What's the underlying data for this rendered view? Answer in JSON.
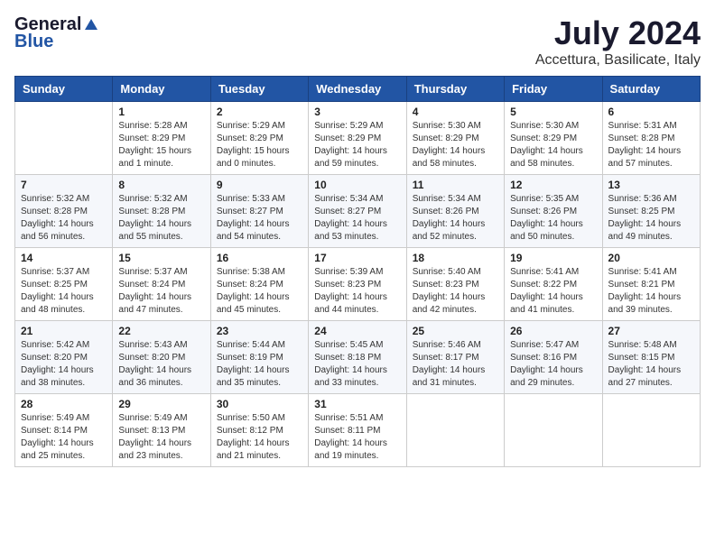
{
  "header": {
    "logo_general": "General",
    "logo_blue": "Blue",
    "month_title": "July 2024",
    "location": "Accettura, Basilicate, Italy"
  },
  "weekdays": [
    "Sunday",
    "Monday",
    "Tuesday",
    "Wednesday",
    "Thursday",
    "Friday",
    "Saturday"
  ],
  "weeks": [
    [
      {
        "day": "",
        "info": ""
      },
      {
        "day": "1",
        "info": "Sunrise: 5:28 AM\nSunset: 8:29 PM\nDaylight: 15 hours\nand 1 minute."
      },
      {
        "day": "2",
        "info": "Sunrise: 5:29 AM\nSunset: 8:29 PM\nDaylight: 15 hours\nand 0 minutes."
      },
      {
        "day": "3",
        "info": "Sunrise: 5:29 AM\nSunset: 8:29 PM\nDaylight: 14 hours\nand 59 minutes."
      },
      {
        "day": "4",
        "info": "Sunrise: 5:30 AM\nSunset: 8:29 PM\nDaylight: 14 hours\nand 58 minutes."
      },
      {
        "day": "5",
        "info": "Sunrise: 5:30 AM\nSunset: 8:29 PM\nDaylight: 14 hours\nand 58 minutes."
      },
      {
        "day": "6",
        "info": "Sunrise: 5:31 AM\nSunset: 8:28 PM\nDaylight: 14 hours\nand 57 minutes."
      }
    ],
    [
      {
        "day": "7",
        "info": "Sunrise: 5:32 AM\nSunset: 8:28 PM\nDaylight: 14 hours\nand 56 minutes."
      },
      {
        "day": "8",
        "info": "Sunrise: 5:32 AM\nSunset: 8:28 PM\nDaylight: 14 hours\nand 55 minutes."
      },
      {
        "day": "9",
        "info": "Sunrise: 5:33 AM\nSunset: 8:27 PM\nDaylight: 14 hours\nand 54 minutes."
      },
      {
        "day": "10",
        "info": "Sunrise: 5:34 AM\nSunset: 8:27 PM\nDaylight: 14 hours\nand 53 minutes."
      },
      {
        "day": "11",
        "info": "Sunrise: 5:34 AM\nSunset: 8:26 PM\nDaylight: 14 hours\nand 52 minutes."
      },
      {
        "day": "12",
        "info": "Sunrise: 5:35 AM\nSunset: 8:26 PM\nDaylight: 14 hours\nand 50 minutes."
      },
      {
        "day": "13",
        "info": "Sunrise: 5:36 AM\nSunset: 8:25 PM\nDaylight: 14 hours\nand 49 minutes."
      }
    ],
    [
      {
        "day": "14",
        "info": "Sunrise: 5:37 AM\nSunset: 8:25 PM\nDaylight: 14 hours\nand 48 minutes."
      },
      {
        "day": "15",
        "info": "Sunrise: 5:37 AM\nSunset: 8:24 PM\nDaylight: 14 hours\nand 47 minutes."
      },
      {
        "day": "16",
        "info": "Sunrise: 5:38 AM\nSunset: 8:24 PM\nDaylight: 14 hours\nand 45 minutes."
      },
      {
        "day": "17",
        "info": "Sunrise: 5:39 AM\nSunset: 8:23 PM\nDaylight: 14 hours\nand 44 minutes."
      },
      {
        "day": "18",
        "info": "Sunrise: 5:40 AM\nSunset: 8:23 PM\nDaylight: 14 hours\nand 42 minutes."
      },
      {
        "day": "19",
        "info": "Sunrise: 5:41 AM\nSunset: 8:22 PM\nDaylight: 14 hours\nand 41 minutes."
      },
      {
        "day": "20",
        "info": "Sunrise: 5:41 AM\nSunset: 8:21 PM\nDaylight: 14 hours\nand 39 minutes."
      }
    ],
    [
      {
        "day": "21",
        "info": "Sunrise: 5:42 AM\nSunset: 8:20 PM\nDaylight: 14 hours\nand 38 minutes."
      },
      {
        "day": "22",
        "info": "Sunrise: 5:43 AM\nSunset: 8:20 PM\nDaylight: 14 hours\nand 36 minutes."
      },
      {
        "day": "23",
        "info": "Sunrise: 5:44 AM\nSunset: 8:19 PM\nDaylight: 14 hours\nand 35 minutes."
      },
      {
        "day": "24",
        "info": "Sunrise: 5:45 AM\nSunset: 8:18 PM\nDaylight: 14 hours\nand 33 minutes."
      },
      {
        "day": "25",
        "info": "Sunrise: 5:46 AM\nSunset: 8:17 PM\nDaylight: 14 hours\nand 31 minutes."
      },
      {
        "day": "26",
        "info": "Sunrise: 5:47 AM\nSunset: 8:16 PM\nDaylight: 14 hours\nand 29 minutes."
      },
      {
        "day": "27",
        "info": "Sunrise: 5:48 AM\nSunset: 8:15 PM\nDaylight: 14 hours\nand 27 minutes."
      }
    ],
    [
      {
        "day": "28",
        "info": "Sunrise: 5:49 AM\nSunset: 8:14 PM\nDaylight: 14 hours\nand 25 minutes."
      },
      {
        "day": "29",
        "info": "Sunrise: 5:49 AM\nSunset: 8:13 PM\nDaylight: 14 hours\nand 23 minutes."
      },
      {
        "day": "30",
        "info": "Sunrise: 5:50 AM\nSunset: 8:12 PM\nDaylight: 14 hours\nand 21 minutes."
      },
      {
        "day": "31",
        "info": "Sunrise: 5:51 AM\nSunset: 8:11 PM\nDaylight: 14 hours\nand 19 minutes."
      },
      {
        "day": "",
        "info": ""
      },
      {
        "day": "",
        "info": ""
      },
      {
        "day": "",
        "info": ""
      }
    ]
  ]
}
